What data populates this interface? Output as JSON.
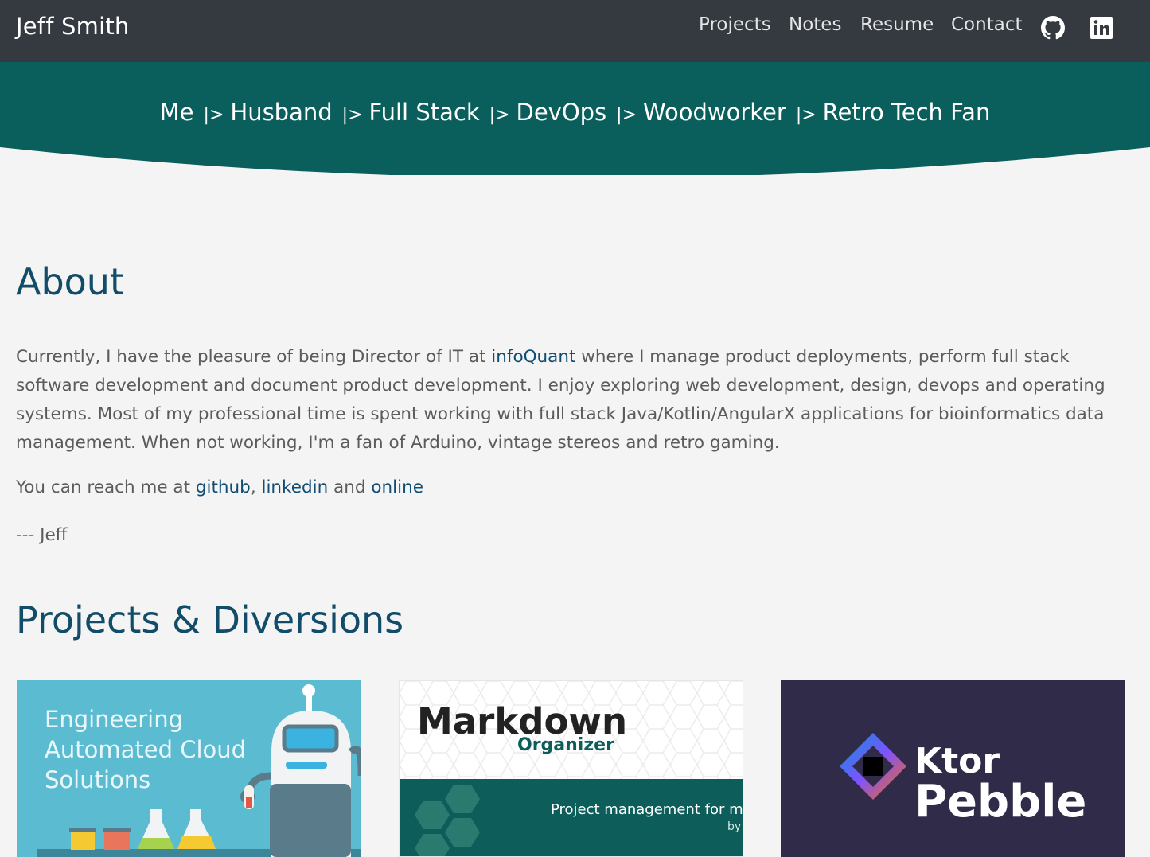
{
  "nav": {
    "brand": "Jeff Smith",
    "links": [
      "Projects",
      "Notes",
      "Resume",
      "Contact"
    ],
    "icons": [
      "github-icon",
      "linkedin-icon"
    ]
  },
  "hero": {
    "segments": [
      "Me",
      "Husband",
      "Full Stack",
      "DevOps",
      "Woodworker",
      "Retro Tech Fan"
    ],
    "separator": "|>",
    "color": "#0a5f5c"
  },
  "about": {
    "title": "About",
    "paragraph_before": "Currently, I have the pleasure of being Director of IT at ",
    "company_link": "infoQuant",
    "paragraph_after": " where I manage product deployments, perform full stack software development and document product development. I enjoy exploring web development, design, devops and operating systems. Most of my professional time is spent working with full stack Java/Kotlin/AngularX applications for bioinformatics data management. When not working, I'm a fan of Arduino, vintage stereos and retro gaming.",
    "reach_prefix": "You can reach me at ",
    "reach_links": [
      "github",
      "linkedin",
      "online"
    ],
    "reach_sep1": ", ",
    "reach_sep2": " and ",
    "signature": "--- Jeff"
  },
  "projects": {
    "title": "Projects & Diversions",
    "cards": [
      {
        "lines": [
          "Engineering",
          "Automated Cloud",
          "Solutions"
        ]
      },
      {
        "title": "Markdown",
        "subtitle": "Organizer",
        "tagline": "Project management for ma",
        "by": "by"
      },
      {
        "title_top": "Ktor",
        "title_bottom": "Pebble"
      }
    ]
  },
  "colors": {
    "topbar": "#343a40",
    "hero": "#0a5f5c",
    "heading": "#114d68",
    "link": "#0f4d73"
  }
}
